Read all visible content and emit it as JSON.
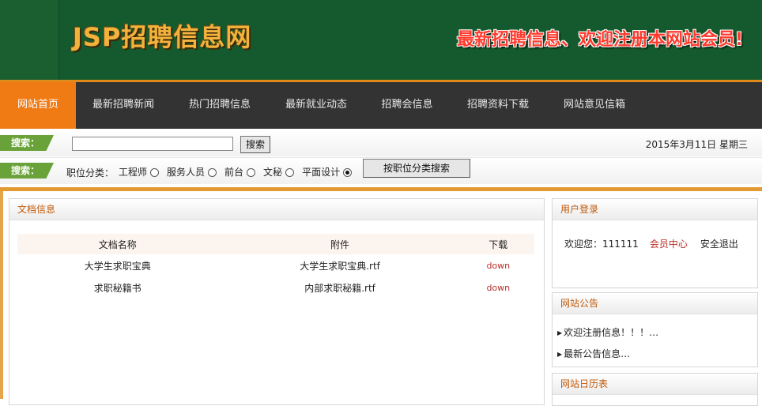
{
  "header": {
    "logo": "JSP招聘信息网",
    "slogan": "最新招聘信息、欢迎注册本网站会员!"
  },
  "nav": {
    "items": [
      "网站首页",
      "最新招聘新闻",
      "热门招聘信息",
      "最新就业动态",
      "招聘会信息",
      "招聘资料下载",
      "网站意见信箱"
    ]
  },
  "search": {
    "tag": "搜索：",
    "input_value": "",
    "button": "搜索",
    "date": "2015年3月11日 星期三"
  },
  "category": {
    "tag": "搜索：",
    "label": "职位分类：",
    "options": [
      "工程师",
      "服务人员",
      "前台",
      "文秘",
      "平面设计"
    ],
    "selected": "平面设计",
    "button": "按职位分类搜索"
  },
  "documents": {
    "title": "文档信息",
    "headers": [
      "文档名称",
      "附件",
      "下载"
    ],
    "rows": [
      {
        "name": "大学生求职宝典",
        "attachment": "大学生求职宝典.rtf",
        "download": "down"
      },
      {
        "name": "求职秘籍书",
        "attachment": "内部求职秘籍.rtf",
        "download": "down"
      }
    ]
  },
  "login": {
    "title": "用户登录",
    "welcome": "欢迎您：111111",
    "member_center": "会员中心",
    "logout": "安全退出"
  },
  "notice": {
    "title": "网站公告",
    "items": [
      "欢迎注册信息！！！…",
      "最新公告信息…"
    ]
  },
  "calendar": {
    "title": "网站日历表"
  },
  "colors": {
    "header_bg": "#145a2e",
    "nav_bg": "#333333",
    "nav_active": "#f07a14",
    "tag_green": "#6aa23a",
    "accent_orange": "#e39a32",
    "panel_title": "#c05a0b",
    "link_red": "#b8312b"
  }
}
